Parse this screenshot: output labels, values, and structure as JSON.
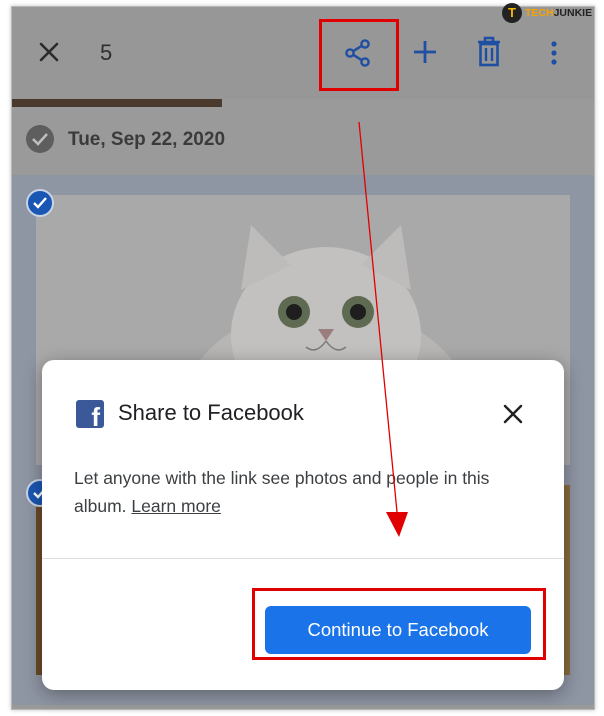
{
  "toolbar": {
    "selected_count": "5",
    "icons": [
      "close-icon",
      "share-icon",
      "add-icon",
      "trash-icon",
      "more-vert-icon"
    ]
  },
  "gallery": {
    "date_label": "Tue, Sep 22, 2020"
  },
  "dialog": {
    "title": "Share to Facebook",
    "body_text": "Let anyone with the link see photos and people in this album.",
    "learn_more_label": "Learn more",
    "continue_label": "Continue to Facebook"
  },
  "watermark": {
    "badge": "T",
    "brand_prefix": "TECH",
    "brand_suffix": "JUNKIE"
  },
  "colors": {
    "accent": "#1a73e8",
    "facebook": "#3b5998",
    "annotation": "#e10000"
  }
}
